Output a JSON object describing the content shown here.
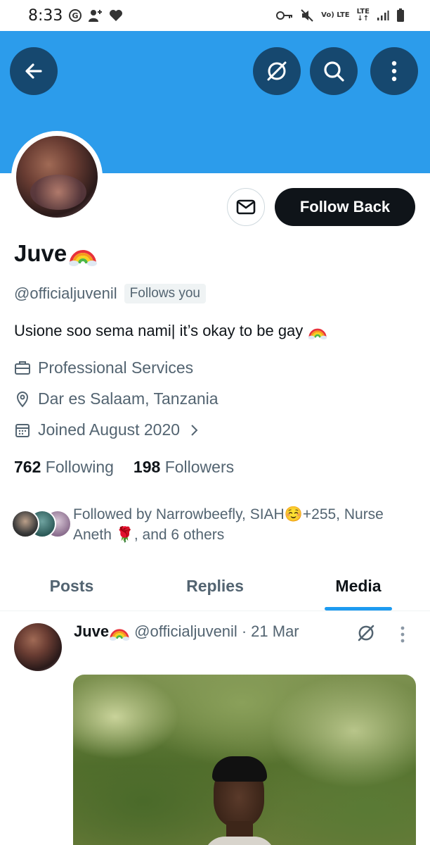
{
  "status_bar": {
    "time": "8:33",
    "lte_top": "LTE",
    "volte_label": "Vo) LTE",
    "lte_arrows": "↓↑"
  },
  "header": {
    "back_icon": "arrow-left-icon",
    "grok_icon": "grok-icon",
    "search_icon": "search-icon",
    "more_icon": "more-vertical-icon",
    "banner_color": "#2c9ceb"
  },
  "actions": {
    "message_icon": "envelope-icon",
    "follow_back_label": "Follow Back"
  },
  "profile": {
    "display_name": "Juve",
    "name_emoji": "rainbow",
    "handle": "@officialjuvenil",
    "follows_you": "Follows you",
    "bio": "Usione soo sema nami| it’s okay to be gay",
    "category": "Professional Services",
    "location": "Dar es Salaam, Tanzania",
    "joined": "Joined August 2020"
  },
  "stats": {
    "following_count": "762",
    "following_label": "Following",
    "followers_count": "198",
    "followers_label": "Followers"
  },
  "followed_by": {
    "text_line1": "Followed by Narrowbeefly, SIAH☺️+255, Nurse",
    "text_line2": "Aneth 🌹, and 6 others"
  },
  "tabs": [
    {
      "label": "Posts",
      "active": false
    },
    {
      "label": "Replies",
      "active": false
    },
    {
      "label": "Media",
      "active": true
    }
  ],
  "post": {
    "author_name": "Juve",
    "author_handle": "@officialjuvenil",
    "separator": "·",
    "date": "21 Mar"
  },
  "colors": {
    "accent": "#1d9bf0",
    "button_dark": "#0f1419",
    "secondary_text": "#536471"
  }
}
